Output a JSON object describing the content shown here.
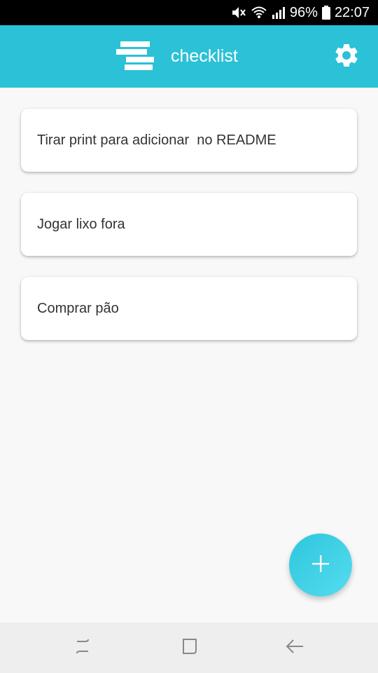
{
  "status_bar": {
    "battery_percent": "96%",
    "time": "22:07",
    "icons": [
      "mute-icon",
      "wifi-icon",
      "signal-icon",
      "battery-icon"
    ]
  },
  "app_bar": {
    "title": "checklist",
    "logo_icon": "stacked-lines-logo-icon",
    "settings_icon": "gear-icon",
    "color": "#2bc1d6"
  },
  "tasks": [
    {
      "text": "Tirar print para adicionar  no README"
    },
    {
      "text": "Jogar lixo fora"
    },
    {
      "text": "Comprar pão"
    }
  ],
  "fab": {
    "icon": "plus-icon",
    "color": "#3fd0e6"
  },
  "nav_bar": {
    "icons": [
      "recent-apps-icon",
      "home-icon",
      "back-icon"
    ]
  }
}
